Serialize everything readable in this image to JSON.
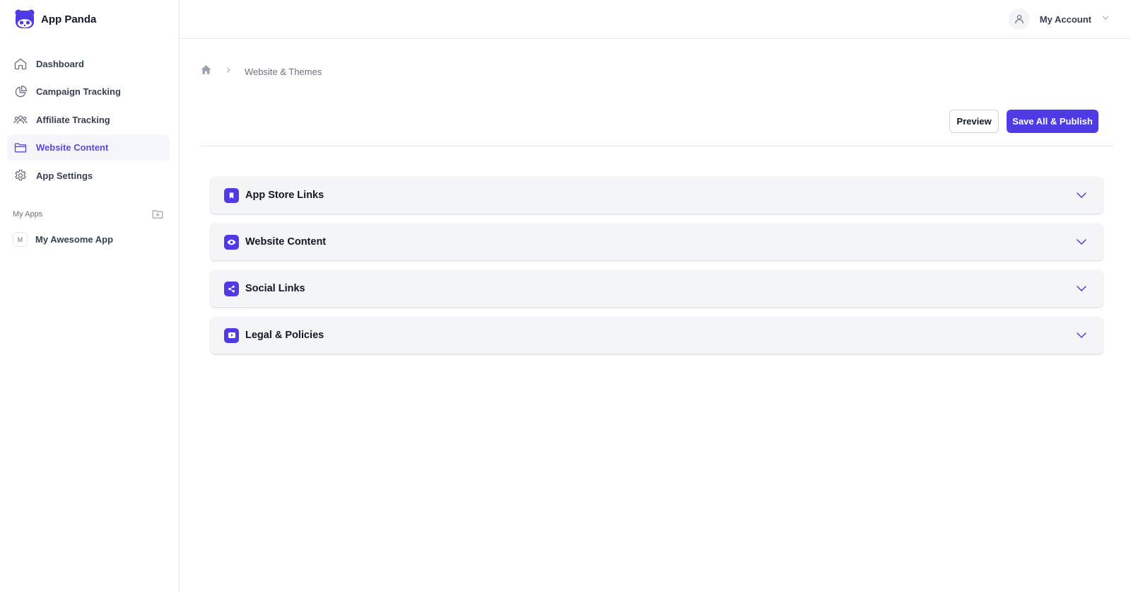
{
  "brand": {
    "name": "App Panda",
    "logo_icon": "panda-icon",
    "accent": "#4f3ae6"
  },
  "sidebar": {
    "items": [
      {
        "label": "Dashboard",
        "icon": "home-icon",
        "active": false
      },
      {
        "label": "Campaign Tracking",
        "icon": "pie-chart-icon",
        "active": false
      },
      {
        "label": "Affiliate Tracking",
        "icon": "users-icon",
        "active": false
      },
      {
        "label": "Website Content",
        "icon": "folder-icon",
        "active": true
      },
      {
        "label": "App Settings",
        "icon": "gear-icon",
        "active": false
      }
    ],
    "apps_title": "My Apps",
    "apps_add_icon": "folder-plus-icon",
    "apps": [
      {
        "badge": "M",
        "name": "My Awesome App"
      }
    ]
  },
  "header": {
    "account_label": "My Account",
    "avatar_icon": "user-icon",
    "menu_icon": "chevron-down-icon"
  },
  "breadcrumb": {
    "home_icon": "home-solid-icon",
    "separator_icon": "chevron-right-icon",
    "current": "Website & Themes"
  },
  "actions": {
    "preview_label": "Preview",
    "publish_label": "Save All & Publish"
  },
  "sections": [
    {
      "title": "App Store Links",
      "icon": "bookmark-icon"
    },
    {
      "title": "Website Content",
      "icon": "eye-icon"
    },
    {
      "title": "Social Links",
      "icon": "share-icon"
    },
    {
      "title": "Legal & Policies",
      "icon": "play-box-icon"
    }
  ]
}
